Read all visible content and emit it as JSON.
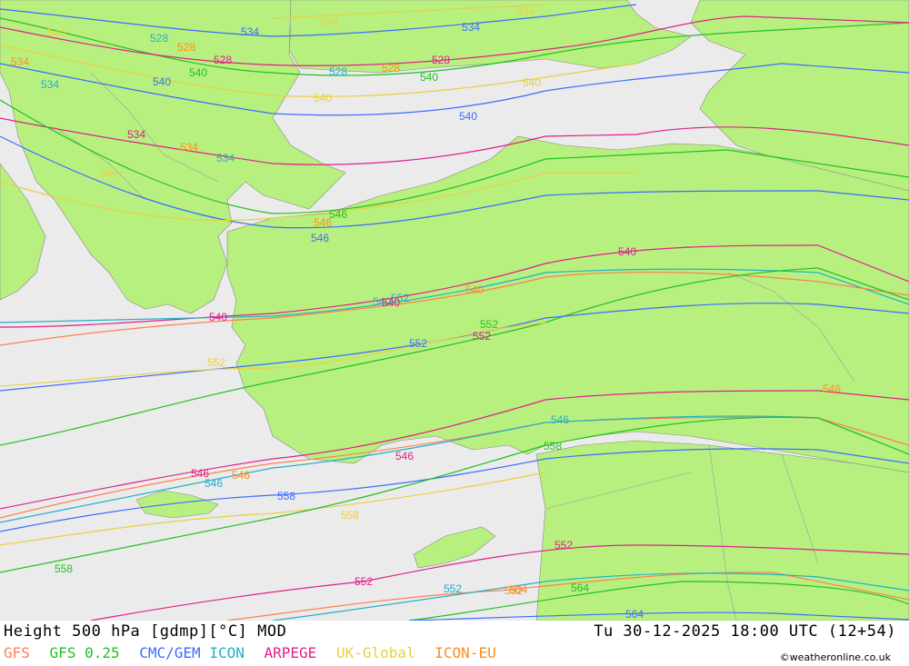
{
  "title": "Height 500 hPa [gdmp][°C] MOD",
  "valid_time": "Tu 30-12-2025 18:00 UTC (12+54)",
  "credit": "©weatheronline.co.uk",
  "models": [
    {
      "name": "GFS",
      "color": "#ff7f50"
    },
    {
      "name": "GFS 0.25",
      "color": "#22c022"
    },
    {
      "name": "CMC/GEM",
      "color": "#3b6cff"
    },
    {
      "name": "ICON",
      "color": "#22b0c8"
    },
    {
      "name": "ARPEGE",
      "color": "#e0208a"
    },
    {
      "name": "UK-Global",
      "color": "#e8d040"
    },
    {
      "name": "ICON-EU",
      "color": "#ff8c20"
    }
  ],
  "colors": {
    "land": "#b8f080",
    "sea": "#ebebeb",
    "border": "#888888"
  },
  "contour_labels": [
    {
      "text": "540",
      "model": "UK-Global"
    },
    {
      "text": "534",
      "model": "ICON-EU"
    },
    {
      "text": "534",
      "model": "ICON"
    },
    {
      "text": "528",
      "model": "ICON"
    },
    {
      "text": "528",
      "model": "ICON-EU"
    },
    {
      "text": "528",
      "model": "ARPEGE"
    },
    {
      "text": "540",
      "model": "GFS 0.25"
    },
    {
      "text": "534",
      "model": "CMC/GEM"
    },
    {
      "text": "534",
      "model": "UK-Global"
    },
    {
      "text": "528",
      "model": "ICON"
    },
    {
      "text": "528",
      "model": "ICON-EU"
    },
    {
      "text": "528",
      "model": "ARPEGE"
    },
    {
      "text": "534",
      "model": "CMC/GEM"
    },
    {
      "text": "534",
      "model": "UK-Global"
    },
    {
      "text": "540",
      "model": "CMC/GEM"
    },
    {
      "text": "540",
      "model": "UK-Global"
    },
    {
      "text": "540",
      "model": "GFS 0.25"
    },
    {
      "text": "540",
      "model": "CMC/GEM"
    },
    {
      "text": "540",
      "model": "UK-Global"
    },
    {
      "text": "534",
      "model": "ARPEGE"
    },
    {
      "text": "534",
      "model": "ICON-EU"
    },
    {
      "text": "534",
      "model": "ICON"
    },
    {
      "text": "546",
      "model": "UK-Global"
    },
    {
      "text": "546",
      "model": "CMC/GEM"
    },
    {
      "text": "546",
      "model": "ICON-EU"
    },
    {
      "text": "546",
      "model": "GFS 0.25"
    },
    {
      "text": "540",
      "model": "ARPEGE"
    },
    {
      "text": "540",
      "model": "ICON-EU"
    },
    {
      "text": "540",
      "model": "ICON"
    },
    {
      "text": "552",
      "model": "GFS 0.25"
    },
    {
      "text": "552",
      "model": "CMC/GEM"
    },
    {
      "text": "552",
      "model": "UK-Global"
    },
    {
      "text": "552",
      "model": "ARPEGE"
    },
    {
      "text": "546",
      "model": "ARPEGE"
    },
    {
      "text": "546",
      "model": "ICON-EU"
    },
    {
      "text": "546",
      "model": "ICON"
    },
    {
      "text": "558",
      "model": "CMC/GEM"
    },
    {
      "text": "558",
      "model": "GFS 0.25"
    },
    {
      "text": "558",
      "model": "UK-Global"
    },
    {
      "text": "552",
      "model": "ARPEGE"
    },
    {
      "text": "552",
      "model": "ICON"
    },
    {
      "text": "552",
      "model": "ICON-EU"
    },
    {
      "text": "564",
      "model": "GFS 0.25"
    },
    {
      "text": "564",
      "model": "CMC/GEM"
    },
    {
      "text": "564",
      "model": "ICON-EU"
    },
    {
      "text": "546",
      "model": "ICON-EU"
    },
    {
      "text": "552",
      "model": "ICON"
    },
    {
      "text": "546",
      "model": "ICON"
    },
    {
      "text": "558",
      "model": "GFS 0.25"
    },
    {
      "text": "540",
      "model": "ARPEGE"
    },
    {
      "text": "552",
      "model": "ARPEGE"
    },
    {
      "text": "546",
      "model": "ARPEGE"
    },
    {
      "text": "540",
      "model": "ARPEGE"
    }
  ]
}
